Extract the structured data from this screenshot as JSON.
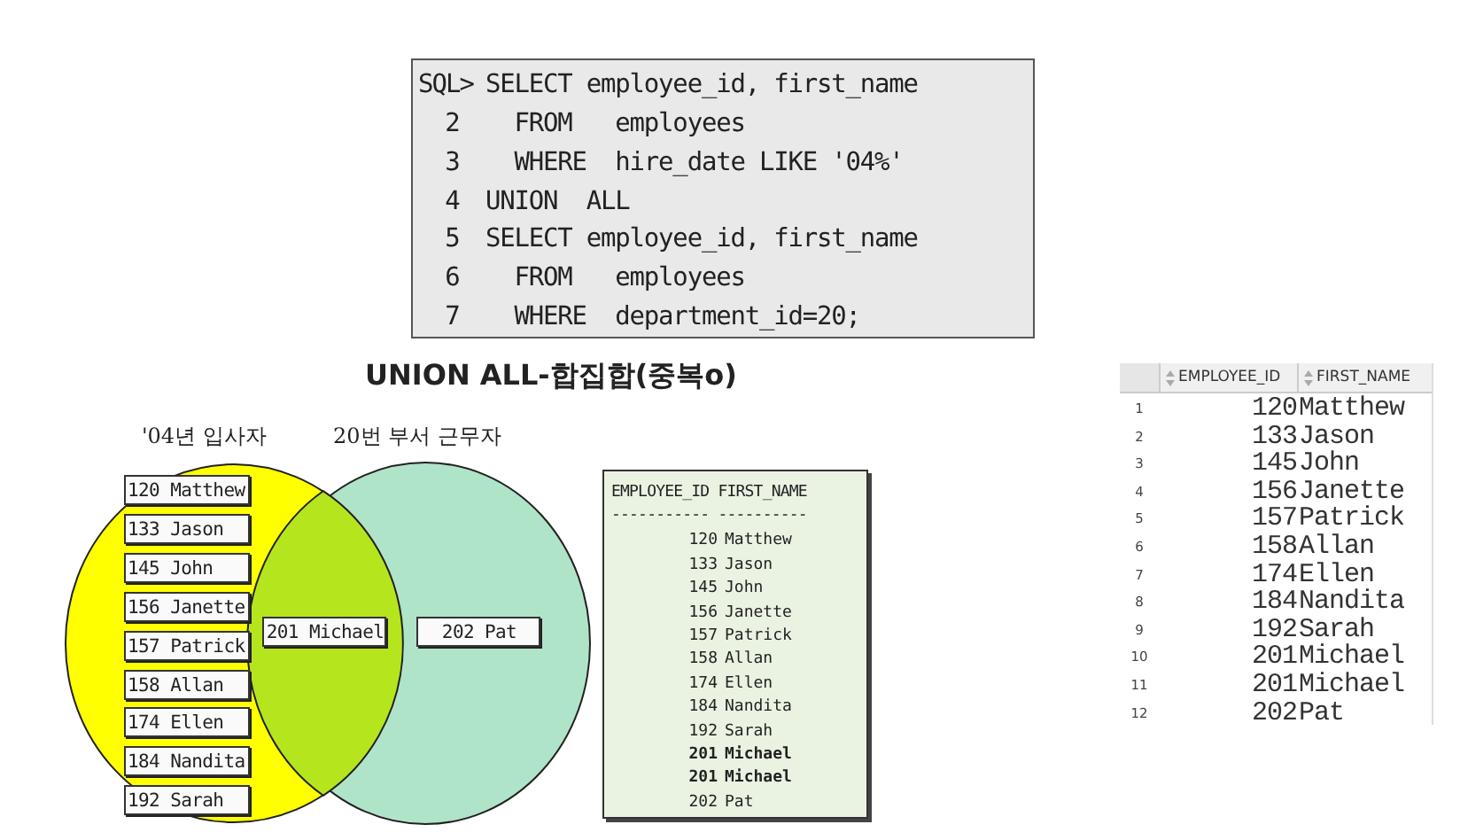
{
  "sql_console": {
    "lines": [
      {
        "number": "SQL>",
        "text": "SELECT employee_id, first_name"
      },
      {
        "number": "2",
        "text": "  FROM   employees"
      },
      {
        "number": "3",
        "text": "  WHERE  hire_date LIKE '04%'"
      },
      {
        "number": "4",
        "text": "UNION  ALL"
      },
      {
        "number": "5",
        "text": "SELECT employee_id, first_name"
      },
      {
        "number": "6",
        "text": "  FROM   employees"
      },
      {
        "number": "7",
        "text": "  WHERE  department_id=20;"
      }
    ]
  },
  "title": "UNION ALL-합집합(중복o)",
  "venn": {
    "left_label": "'04년 입사자",
    "right_label": "20번 부서 근무자",
    "left_items": [
      "120 Matthew",
      "133 Jason",
      "145 John",
      "156 Janette",
      "157 Patrick",
      "158 Allan",
      "174 Ellen",
      "184 Nandita",
      "192 Sarah"
    ],
    "middle_items": [
      "201 Michael"
    ],
    "right_items": [
      "202 Pat"
    ]
  },
  "text_result": {
    "header": "EMPLOYEE_ID FIRST_NAME",
    "separator": "----------- ----------",
    "rows": [
      {
        "id": "120",
        "name": "Matthew",
        "bold": false
      },
      {
        "id": "133",
        "name": "Jason",
        "bold": false
      },
      {
        "id": "145",
        "name": "John",
        "bold": false
      },
      {
        "id": "156",
        "name": "Janette",
        "bold": false
      },
      {
        "id": "157",
        "name": "Patrick",
        "bold": false
      },
      {
        "id": "158",
        "name": "Allan",
        "bold": false
      },
      {
        "id": "174",
        "name": "Ellen",
        "bold": false
      },
      {
        "id": "184",
        "name": "Nandita",
        "bold": false
      },
      {
        "id": "192",
        "name": "Sarah",
        "bold": false
      },
      {
        "id": "201",
        "name": "Michael",
        "bold": true
      },
      {
        "id": "201",
        "name": "Michael",
        "bold": true
      },
      {
        "id": "202",
        "name": "Pat",
        "bold": false
      }
    ]
  },
  "result_grid": {
    "columns": [
      "EMPLOYEE_ID",
      "FIRST_NAME"
    ],
    "rows": [
      {
        "number": "1",
        "id": "120",
        "name": "Matthew"
      },
      {
        "number": "2",
        "id": "133",
        "name": "Jason"
      },
      {
        "number": "3",
        "id": "145",
        "name": "John"
      },
      {
        "number": "4",
        "id": "156",
        "name": "Janette"
      },
      {
        "number": "5",
        "id": "157",
        "name": "Patrick"
      },
      {
        "number": "6",
        "id": "158",
        "name": "Allan"
      },
      {
        "number": "7",
        "id": "174",
        "name": "Ellen"
      },
      {
        "number": "8",
        "id": "184",
        "name": "Nandita"
      },
      {
        "number": "9",
        "id": "192",
        "name": "Sarah"
      },
      {
        "number": "10",
        "id": "201",
        "name": "Michael"
      },
      {
        "number": "11",
        "id": "201",
        "name": "Michael"
      },
      {
        "number": "12",
        "id": "202",
        "name": "Pat"
      }
    ]
  }
}
